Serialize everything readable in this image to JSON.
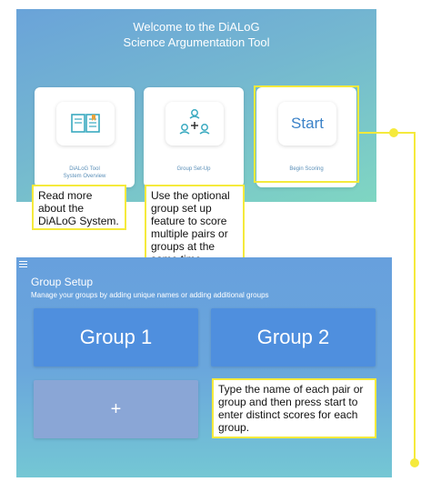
{
  "welcome": {
    "title": "Welcome to the DiALoG\nScience Argumentation Tool",
    "cards": [
      {
        "icon": "book-icon",
        "label": "DiALoG Tool\nSystem Overview"
      },
      {
        "icon": "group-setup-icon",
        "label": "Group Set-Up"
      },
      {
        "icon_text": "Start",
        "label": "Begin Scoring"
      }
    ]
  },
  "callouts": {
    "overview": "Read more about the DiALoG System.",
    "group_setup": "Use the optional group set up feature to score multiple pairs or groups at the same time.",
    "start": "Type the name of each pair or group and then press start to enter distinct scores for each group."
  },
  "group_setup": {
    "title": "Group Setup",
    "subtitle": "Manage your groups by adding unique names or adding additional groups",
    "groups": [
      "Group 1",
      "Group 2"
    ],
    "add_label": "+"
  },
  "colors": {
    "callout_border": "#f5ea3c",
    "tile": "#4f8fde",
    "accent": "#3b82c8"
  }
}
